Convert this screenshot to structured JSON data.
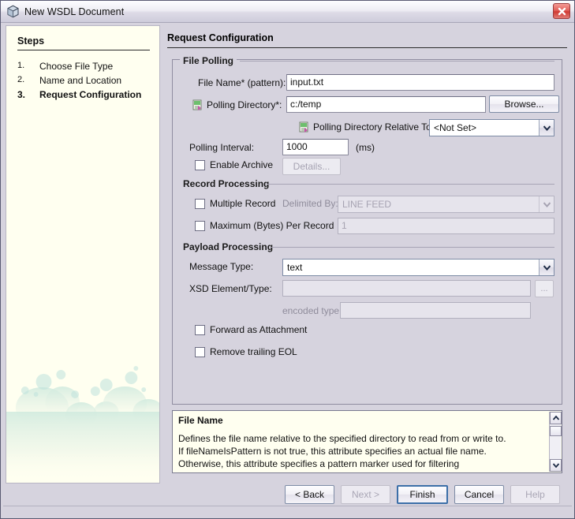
{
  "window": {
    "title": "New WSDL Document",
    "icon": "cube-icon",
    "close_label": "✕"
  },
  "sidebar": {
    "heading": "Steps",
    "steps": [
      {
        "num": "1.",
        "label": "Choose File Type",
        "active": false
      },
      {
        "num": "2.",
        "label": "Name and Location",
        "active": false
      },
      {
        "num": "3.",
        "label": "Request Configuration",
        "active": true
      }
    ]
  },
  "main": {
    "page_title": "Request Configuration",
    "sections": {
      "file_polling": {
        "title": "File Polling",
        "file_name_label": "File Name* (pattern):",
        "file_name_value": "input.txt",
        "polling_dir_label": "Polling Directory*:",
        "polling_dir_value": "c:/temp",
        "browse_label": "Browse...",
        "relative_to_label": "Polling Directory Relative To:",
        "relative_to_value": "<Not Set>",
        "interval_label": "Polling Interval:",
        "interval_value": "1000",
        "interval_units": "(ms)",
        "enable_archive_label": "Enable Archive",
        "enable_archive_checked": false,
        "details_label": "Details..."
      },
      "record_processing": {
        "title": "Record Processing",
        "multiple_record_label": "Multiple Record",
        "multiple_record_checked": false,
        "delimited_by_label": "Delimited By:",
        "delimited_by_value": "LINE FEED",
        "max_bytes_label": "Maximum (Bytes) Per Record",
        "max_bytes_checked": false,
        "max_bytes_value": "1"
      },
      "payload_processing": {
        "title": "Payload Processing",
        "message_type_label": "Message Type:",
        "message_type_value": "text",
        "xsd_label": "XSD Element/Type:",
        "xsd_value": "",
        "xsd_browse_label": "...",
        "encoded_type_label": "encoded type:",
        "encoded_type_value": "",
        "forward_attachment_label": "Forward as Attachment",
        "forward_attachment_checked": false,
        "remove_eol_label": "Remove trailing EOL",
        "remove_eol_checked": false
      }
    },
    "help": {
      "title": "File Name",
      "lines": [
        "Defines the file name relative to the specified directory to read from or write to.",
        "If fileNameIsPattern is not true, this attribute specifies an actual file name.",
        "Otherwise, this attribute specifies a pattern marker used for filtering"
      ]
    }
  },
  "footer": {
    "back": "< Back",
    "next": "Next >",
    "finish": "Finish",
    "cancel": "Cancel",
    "help": "Help"
  }
}
